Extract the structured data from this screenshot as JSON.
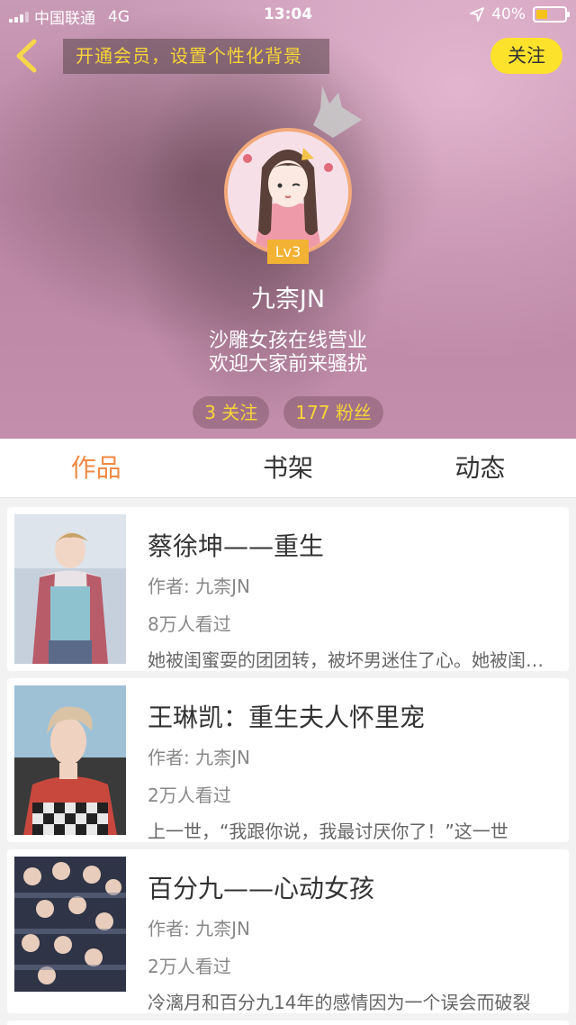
{
  "status_bar": {
    "carrier": "中国联通",
    "network": "4G",
    "time": "13:04",
    "battery_percent": "40%",
    "battery_level": 0.4
  },
  "header": {
    "vip_banner": "开通会员，设置个性化背景",
    "follow_label": "关注",
    "level": "Lv3",
    "nickname": "九柰JN",
    "bio_line1": "沙雕女孩在线营业",
    "bio_line2": "欢迎大家前来骚扰",
    "following": "3 关注",
    "followers": "177 粉丝"
  },
  "tabs": [
    {
      "label": "作品",
      "active": true
    },
    {
      "label": "书架",
      "active": false
    },
    {
      "label": "动态",
      "active": false
    }
  ],
  "works": [
    {
      "title": "蔡徐坤——重生",
      "author": "作者: 九柰JN",
      "views": "8万人看过",
      "desc": "她被闺蜜耍的团团转，被坏男迷住了心。她被闺蜜耍的团团转"
    },
    {
      "title": "王琳凯：重生夫人怀里宠",
      "author": "作者: 九柰JN",
      "views": "2万人看过",
      "desc": "上一世，“我跟你说，我最讨厌你了！”这一世"
    },
    {
      "title": "百分九——心动女孩",
      "author": "作者: 九柰JN",
      "views": "2万人看过",
      "desc": "冷漓月和百分九14年的感情因为一个误会而破裂"
    }
  ],
  "colors": {
    "accent": "#f08a45",
    "follow_button": "#fde22b",
    "banner_text": "#f8d43a"
  }
}
